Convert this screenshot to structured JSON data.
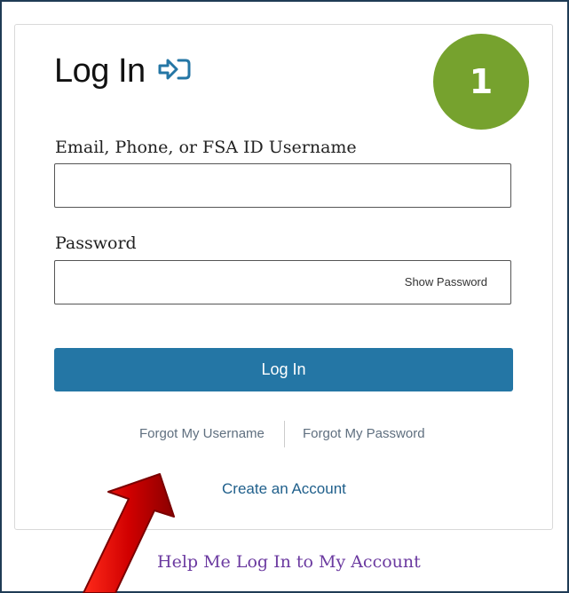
{
  "login": {
    "title": "Log In",
    "step_number": "1",
    "email_label": "Email, Phone, or FSA ID Username",
    "email_value": "",
    "password_label": "Password",
    "password_value": "",
    "show_password": "Show Password",
    "submit_label": "Log In",
    "forgot_username": "Forgot My Username",
    "forgot_password": "Forgot My Password",
    "create_account": "Create an Account",
    "help_link": "Help Me Log In to My Account"
  },
  "colors": {
    "button_blue": "#2476a5",
    "badge_green": "#76a22e",
    "help_purple": "#6b3aa0",
    "arrow_red": "#d10000"
  },
  "icons": {
    "title_icon": "login-arrow-icon",
    "annotation": "red-arrow-icon"
  }
}
